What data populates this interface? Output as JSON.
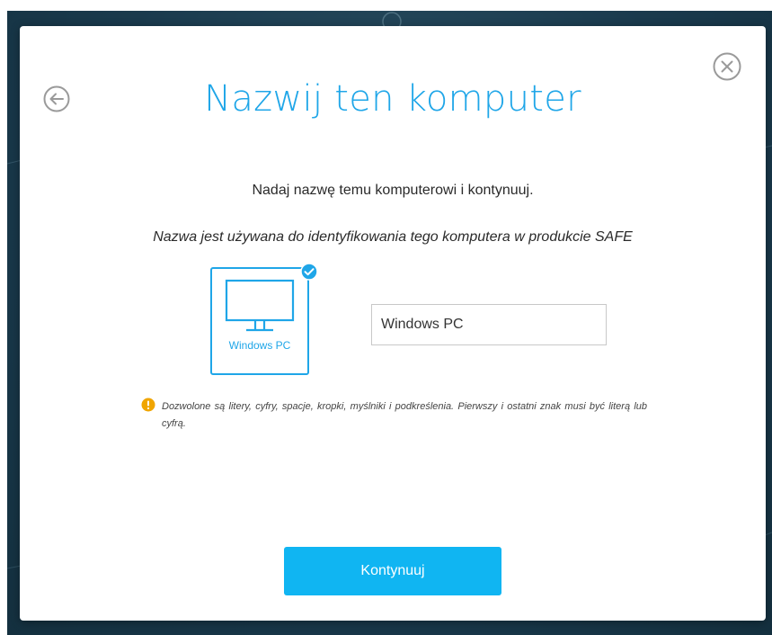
{
  "dialog": {
    "title": "Nazwij ten komputer",
    "subtitle": "Nadaj nazwę temu komputerowi i kontynuuj.",
    "info": "Nazwa jest używana do identyfikowania tego komputera w produkcie SAFE",
    "device": {
      "label": "Windows PC",
      "icon": "monitor-icon",
      "selected": true
    },
    "name_input": {
      "value": "Windows PC",
      "placeholder": ""
    },
    "hint": "Dozwolone są litery, cyfry, spacje, kropki, myślniki i podkreślenia. Pierwszy i ostatni znak musi być literą lub cyfrą.",
    "continue_label": "Kontynuuj",
    "icons": {
      "back": "arrow-left-circle-icon",
      "close": "close-circle-icon",
      "warning": "warning-icon",
      "check": "check-badge-icon"
    }
  },
  "colors": {
    "accent": "#1fa6e8",
    "button": "#10b5f2",
    "warning": "#f0a500",
    "backdrop": "#1a3a4d"
  }
}
